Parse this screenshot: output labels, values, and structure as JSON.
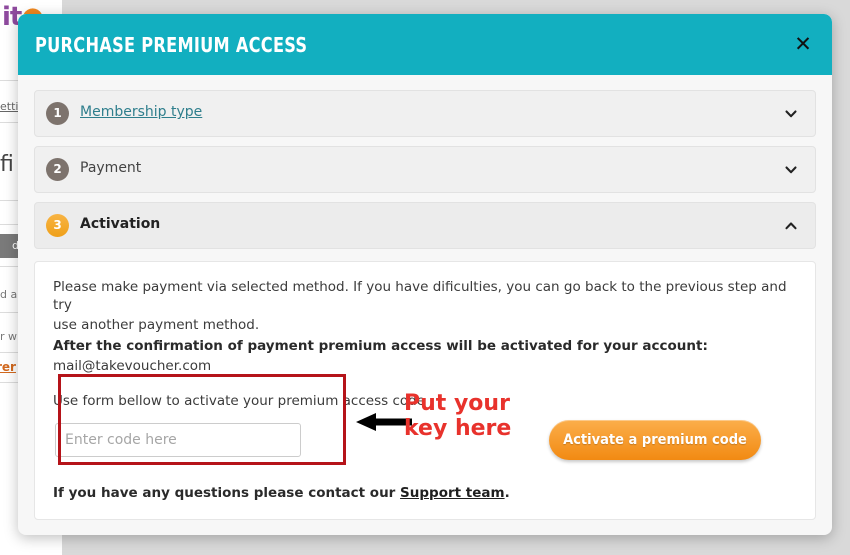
{
  "background": {
    "logo_text": "it",
    "logo_mark": "…",
    "settings_fragment": "ettin",
    "heading_fragment": "fi",
    "gray_button_fragment": "d",
    "fragment_da": "d a",
    "fragment_rw": "r w",
    "orange_link_fragment": "rer"
  },
  "modal": {
    "title": "Purchase Premium Access",
    "close_label": "✕",
    "close_icon_name": "close-icon",
    "header_color": "#12AFC0",
    "accent_orange": "#F5A623",
    "steps": [
      {
        "number": "1",
        "label": "Membership type",
        "state": "link",
        "badge_color": "#7D736D",
        "chevron": "chevron-down-icon",
        "expanded": false
      },
      {
        "number": "2",
        "label": "Payment",
        "state": "plain",
        "badge_color": "#7D736D",
        "chevron": "chevron-down-icon",
        "expanded": false
      },
      {
        "number": "3",
        "label": "Activation",
        "state": "active",
        "badge_color": "#F5A623",
        "chevron": "chevron-up-icon",
        "expanded": true
      }
    ],
    "activation": {
      "intro_line1": "Please make payment via selected method. If you have dificulties, you can go back to the previous step and try",
      "intro_line2": "use another payment method.",
      "confirmation_line": "After the confirmation of payment premium access will be activated for your account:",
      "account_email": "mail@takevoucher.com",
      "use_form_line": "Use form bellow to activate your premium access code",
      "code_placeholder": "Enter code here",
      "code_value": "",
      "activate_button_label": "Activate a premium code",
      "support_prefix": "If you have any questions please contact our ",
      "support_link_label": "Support team",
      "support_suffix": "."
    }
  },
  "annotation": {
    "text_line1": "Put your",
    "text_line2": "key here",
    "box_color": "#B51319",
    "text_color": "#E8322C",
    "arrow_icon_name": "left-arrow-icon"
  }
}
